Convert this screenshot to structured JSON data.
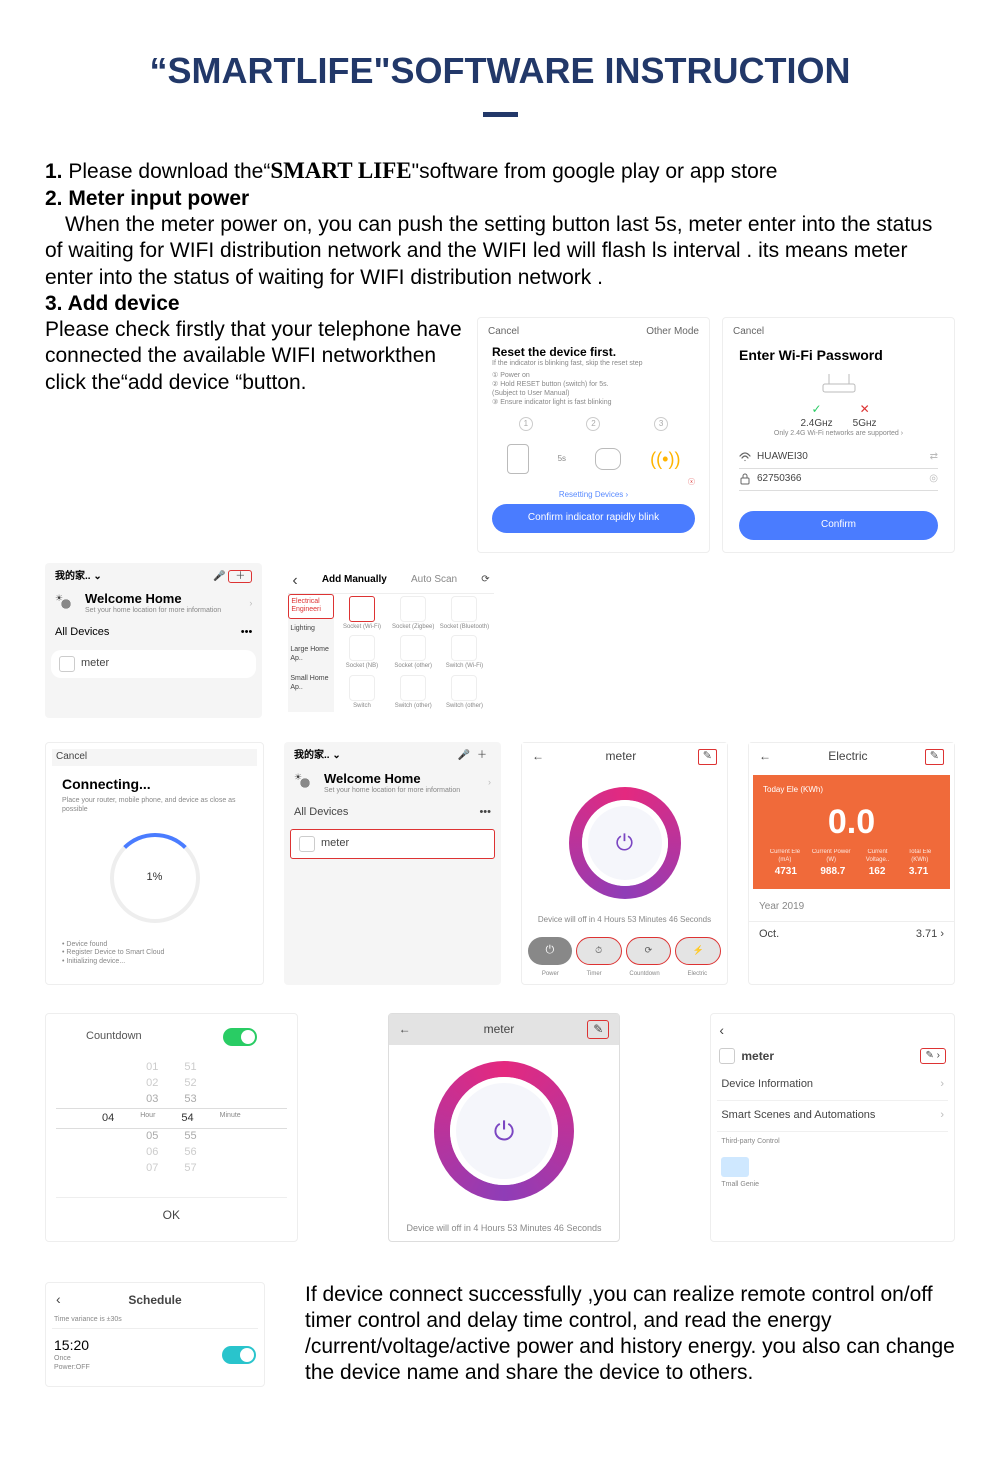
{
  "title": "“SMARTLIFE\"SOFTWARE INSTRUCTION",
  "step1_num": "1.",
  "step1_a": " Please download the“",
  "step1_app": "SMART LIFE",
  "step1_b": "\"software from google play or app store",
  "step2_num": "2. Meter input power",
  "step2_text": "When the meter power on, you can push the setting button last 5s, meter enter into the status of waiting for WIFI distribution network and the WIFI led will flash ls interval . its means meter enter into the status of waiting for WIFI distribution network .",
  "step3_num": "3. Add device",
  "step3_text": "Please check firstly that your telephone have connected the available WIFI networkthen click the“add device “button.",
  "final_text": "If device connect successfully ,you can realize remote control on/off timer control and delay time control, and read the energy /current/voltage/active power and history energy. you also can change the device name and share the device to others.",
  "home": {
    "location": "我的家.. ⌄",
    "welcome": "Welcome Home",
    "sub": "Set your home location for more information",
    "all": "All Devices",
    "device": "meter"
  },
  "addmanual": {
    "back": "‹",
    "t1": "Add Manually",
    "t2": "Auto Scan",
    "cat0": "Electrical Engineeri",
    "cat1": "Lighting",
    "cat2": "Large Home Ap..",
    "cat3": "Small Home Ap..",
    "p1": "Socket (Wi-Fi)",
    "p2": "Socket (Zigbee)",
    "p3": "Socket (Bluetooth)",
    "p4": "Socket (NB)",
    "p5": "Socket (other)",
    "p6": "Switch (Wi-Fi)",
    "p7": "Switch",
    "p8": "Switch (other)",
    "p9": "Switch (other)"
  },
  "reset": {
    "cancel": "Cancel",
    "mode": "Other Mode",
    "title": "Reset the device first.",
    "sub": "If the indicator is blinking fast, skip the reset step",
    "l1": "①  Power on",
    "l2": "②  Hold RESET button (switch) for 5s.",
    "l2b": "(Subject to User Manual)",
    "l3": "③  Ensure indicator light is fast blinking",
    "five": "5s",
    "resetting": "Resetting Devices ›",
    "confirm": "Confirm indicator rapidly blink"
  },
  "wifi": {
    "cancel": "Cancel",
    "title": "Enter Wi-Fi Password",
    "g24": "2.4Gʜᴢ",
    "g5": "5Gʜᴢ",
    "only": "Only 2.4G Wi-Fi networks are supported ›",
    "ssid": "HUAWEI30",
    "pwd": "62750366",
    "confirm": "Confirm"
  },
  "connecting": {
    "cancel": "Cancel",
    "title": "Connecting...",
    "sub": "Place your router, mobile phone, and device as close as possible",
    "pct": "1%",
    "l1": "Device found",
    "l2": "Register Device to Smart Cloud",
    "l3": "Initializing device..."
  },
  "meter": {
    "back": "←",
    "name": "meter",
    "msg": "Device will off in 4 Hours 53 Minutes 46 Seconds",
    "a0": "Power",
    "a1": "Timer",
    "a2": "Countdown",
    "a3": "Electric"
  },
  "electric": {
    "back": "←",
    "name": "Electric",
    "today": "Today Ele (KWh)",
    "val": "0.0",
    "c0l": "Current Ele (mA)",
    "c0v": "4731",
    "c1l": "Current Power (W)",
    "c1v": "988.7",
    "c2l": "Current Voltage..",
    "c2v": "162",
    "c3l": "Total Ele (KWh)",
    "c3v": "3.71",
    "year": "Year 2019",
    "month": "Oct.",
    "monthv": "3.71 ›"
  },
  "countdown": {
    "title": "Countdown",
    "h": "04",
    "hl": "Hour",
    "m": "54",
    "ml": "Minute",
    "ok": "OK"
  },
  "settings": {
    "name": "meter",
    "r1": "Device Information",
    "r2": "Smart Scenes and Automations",
    "r3": "Third-party Control",
    "r4": "Tmall Genie"
  },
  "schedule": {
    "title": "Schedule",
    "note": "Time variance is ±30s",
    "time": "15:20",
    "l1": "Once",
    "l2": "Power:OFF"
  }
}
